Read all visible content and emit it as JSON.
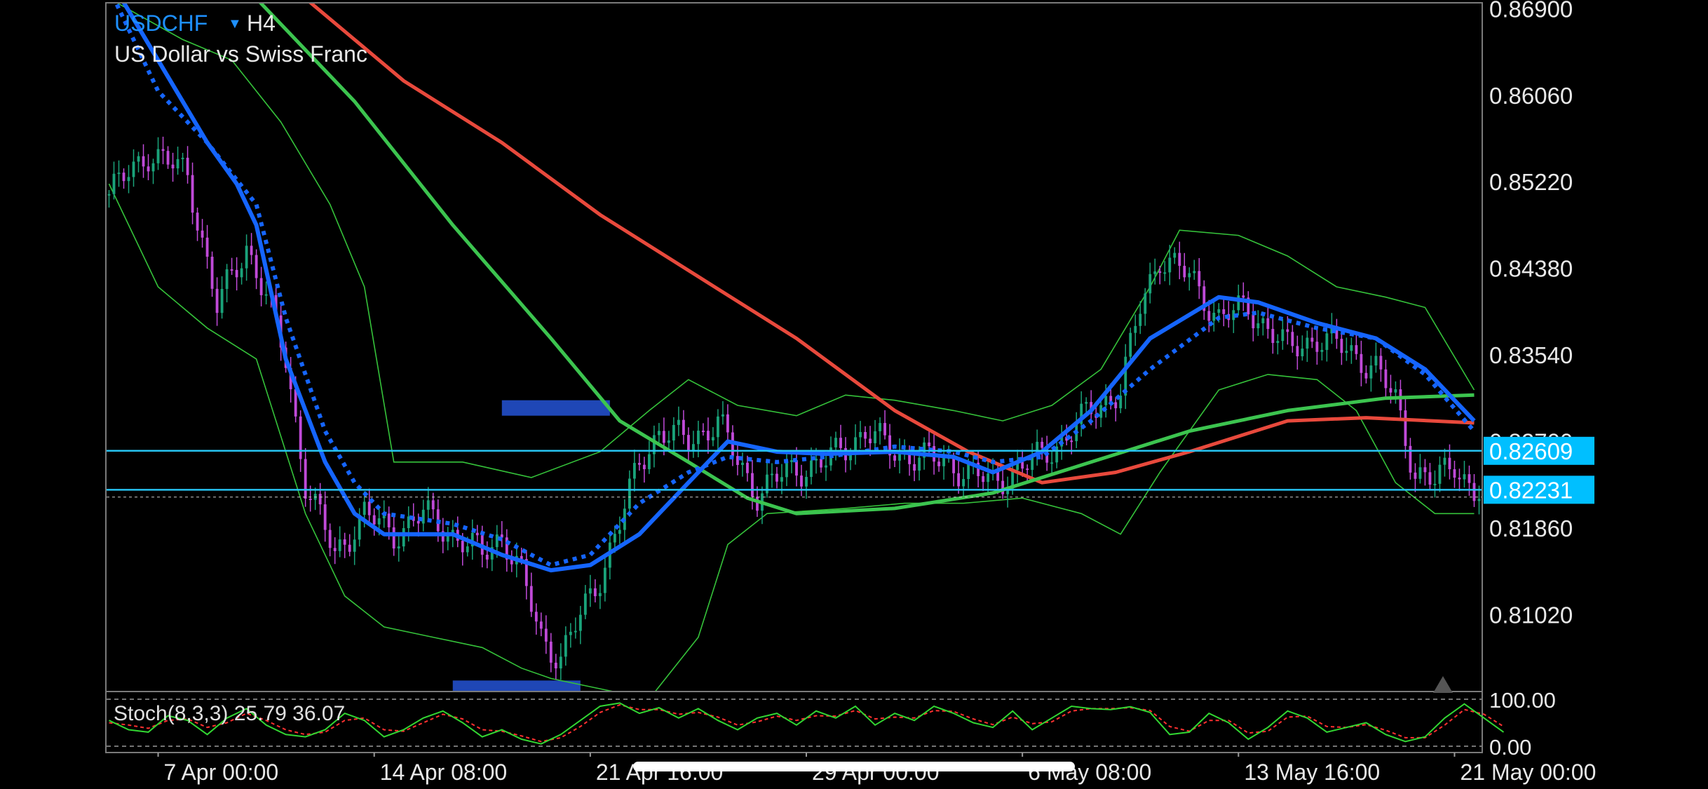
{
  "header": {
    "symbol": "USDCHF",
    "dropdown_glyph": "▼",
    "timeframe": "H4",
    "description": "US Dollar vs Swiss Franc"
  },
  "colors": {
    "background": "#000000",
    "frame": "#7a7a7a",
    "symbol": "#1E90FF",
    "bull_candle": "#1aa37a",
    "bear_candle": "#c04ad8",
    "ema_fast": "#1565ff",
    "ema_slow_dotted": "#1565ff",
    "ma_green": "#3cc44f",
    "ma_red": "#e8493c",
    "bollinger": "#35c23a",
    "hline": "#27c3f2",
    "price_tag_bg": "#00bfff",
    "zone_box": "#1f47b6",
    "stoch_main": "#32d632",
    "stoch_signal": "#ff3030"
  },
  "price_axis": {
    "labels": [
      "0.86900",
      "0.86060",
      "0.85220",
      "0.84380",
      "0.83540",
      "0.82700",
      "0.81860",
      "0.81020"
    ],
    "values": [
      0.869,
      0.8606,
      0.8522,
      0.8438,
      0.8354,
      0.827,
      0.8186,
      0.8102
    ],
    "tags": [
      {
        "label": "0.82609",
        "value": 0.82609
      },
      {
        "label": "0.82231",
        "value": 0.82231
      }
    ]
  },
  "time_axis": {
    "labels": [
      "7 Apr 00:00",
      "14 Apr 08:00",
      "21 Apr 16:00",
      "29 Apr 00:00",
      "6 May 08:00",
      "13 May 16:00",
      "21 May 00:00"
    ],
    "bar_index": [
      10,
      54,
      98,
      142,
      186,
      230,
      274
    ]
  },
  "chart_data": {
    "type": "candlestick",
    "symbol": "USDCHF",
    "timeframe": "H4",
    "ylim": [
      0.8028,
      0.8695
    ],
    "bar_count": 280,
    "horizontal_lines": [
      0.82609,
      0.82231
    ],
    "support_zone_boxes": [
      {
        "from_bar": 80,
        "to_bar": 102,
        "price_top": 0.831,
        "price_bottom": 0.8295
      },
      {
        "from_bar": 70,
        "to_bar": 96,
        "price_top": 0.8038,
        "price_bottom": 0.8025
      }
    ],
    "ema_fast": [
      [
        0,
        0.872
      ],
      [
        10,
        0.864
      ],
      [
        20,
        0.856
      ],
      [
        26,
        0.852
      ],
      [
        30,
        0.848
      ],
      [
        36,
        0.835
      ],
      [
        44,
        0.825
      ],
      [
        50,
        0.82
      ],
      [
        56,
        0.818
      ],
      [
        70,
        0.818
      ],
      [
        80,
        0.816
      ],
      [
        90,
        0.8145
      ],
      [
        98,
        0.815
      ],
      [
        108,
        0.818
      ],
      [
        118,
        0.823
      ],
      [
        126,
        0.827
      ],
      [
        136,
        0.826
      ],
      [
        146,
        0.8258
      ],
      [
        160,
        0.826
      ],
      [
        172,
        0.8255
      ],
      [
        180,
        0.824
      ],
      [
        190,
        0.826
      ],
      [
        200,
        0.83
      ],
      [
        212,
        0.837
      ],
      [
        226,
        0.841
      ],
      [
        234,
        0.8405
      ],
      [
        246,
        0.8385
      ],
      [
        258,
        0.837
      ],
      [
        268,
        0.834
      ],
      [
        278,
        0.829
      ]
    ],
    "ema_slow_dotted": [
      [
        0,
        0.871
      ],
      [
        10,
        0.861
      ],
      [
        20,
        0.856
      ],
      [
        30,
        0.85
      ],
      [
        36,
        0.839
      ],
      [
        44,
        0.828
      ],
      [
        50,
        0.823
      ],
      [
        56,
        0.82
      ],
      [
        70,
        0.819
      ],
      [
        80,
        0.8175
      ],
      [
        90,
        0.815
      ],
      [
        98,
        0.816
      ],
      [
        108,
        0.821
      ],
      [
        118,
        0.824
      ],
      [
        126,
        0.8255
      ],
      [
        136,
        0.825
      ],
      [
        146,
        0.8255
      ],
      [
        160,
        0.8265
      ],
      [
        172,
        0.826
      ],
      [
        180,
        0.825
      ],
      [
        190,
        0.8255
      ],
      [
        200,
        0.829
      ],
      [
        212,
        0.834
      ],
      [
        226,
        0.839
      ],
      [
        234,
        0.8395
      ],
      [
        246,
        0.838
      ],
      [
        258,
        0.837
      ],
      [
        268,
        0.8335
      ],
      [
        278,
        0.828
      ]
    ],
    "ma_green": [
      [
        30,
        0.87
      ],
      [
        50,
        0.86
      ],
      [
        70,
        0.848
      ],
      [
        90,
        0.837
      ],
      [
        104,
        0.829
      ],
      [
        118,
        0.825
      ],
      [
        130,
        0.8215
      ],
      [
        140,
        0.82
      ],
      [
        160,
        0.8205
      ],
      [
        180,
        0.822
      ],
      [
        200,
        0.825
      ],
      [
        220,
        0.828
      ],
      [
        240,
        0.83
      ],
      [
        260,
        0.8312
      ],
      [
        278,
        0.8315
      ]
    ],
    "ma_red": [
      [
        40,
        0.87
      ],
      [
        60,
        0.862
      ],
      [
        80,
        0.856
      ],
      [
        100,
        0.849
      ],
      [
        120,
        0.843
      ],
      [
        140,
        0.837
      ],
      [
        160,
        0.83
      ],
      [
        175,
        0.826
      ],
      [
        190,
        0.823
      ],
      [
        205,
        0.824
      ],
      [
        220,
        0.826
      ],
      [
        240,
        0.829
      ],
      [
        256,
        0.8293
      ],
      [
        278,
        0.8288
      ]
    ],
    "bollinger_upper": [
      [
        0,
        0.87
      ],
      [
        15,
        0.866
      ],
      [
        25,
        0.864
      ],
      [
        35,
        0.858
      ],
      [
        45,
        0.85
      ],
      [
        52,
        0.842
      ],
      [
        58,
        0.825
      ],
      [
        72,
        0.825
      ],
      [
        86,
        0.8235
      ],
      [
        100,
        0.826
      ],
      [
        110,
        0.83
      ],
      [
        118,
        0.833
      ],
      [
        128,
        0.8305
      ],
      [
        140,
        0.8295
      ],
      [
        150,
        0.8315
      ],
      [
        160,
        0.831
      ],
      [
        172,
        0.83
      ],
      [
        182,
        0.829
      ],
      [
        192,
        0.8305
      ],
      [
        202,
        0.834
      ],
      [
        212,
        0.842
      ],
      [
        218,
        0.8475
      ],
      [
        230,
        0.847
      ],
      [
        240,
        0.845
      ],
      [
        250,
        0.842
      ],
      [
        260,
        0.841
      ],
      [
        268,
        0.84
      ],
      [
        278,
        0.832
      ]
    ],
    "bollinger_lower": [
      [
        0,
        0.852
      ],
      [
        10,
        0.842
      ],
      [
        20,
        0.838
      ],
      [
        30,
        0.835
      ],
      [
        40,
        0.82
      ],
      [
        48,
        0.812
      ],
      [
        56,
        0.809
      ],
      [
        66,
        0.808
      ],
      [
        76,
        0.807
      ],
      [
        84,
        0.805
      ],
      [
        90,
        0.804
      ],
      [
        100,
        0.803
      ],
      [
        110,
        0.802
      ],
      [
        120,
        0.808
      ],
      [
        126,
        0.817
      ],
      [
        134,
        0.82
      ],
      [
        150,
        0.8205
      ],
      [
        162,
        0.821
      ],
      [
        174,
        0.821
      ],
      [
        186,
        0.8215
      ],
      [
        198,
        0.82
      ],
      [
        206,
        0.818
      ],
      [
        214,
        0.824
      ],
      [
        226,
        0.832
      ],
      [
        236,
        0.8335
      ],
      [
        246,
        0.833
      ],
      [
        254,
        0.83
      ],
      [
        262,
        0.823
      ],
      [
        270,
        0.82
      ],
      [
        278,
        0.82
      ]
    ],
    "price_path": [
      [
        0,
        0.851
      ],
      [
        8,
        0.855
      ],
      [
        16,
        0.853
      ],
      [
        22,
        0.84
      ],
      [
        28,
        0.846
      ],
      [
        32,
        0.841
      ],
      [
        36,
        0.835
      ],
      [
        40,
        0.823
      ],
      [
        46,
        0.816
      ],
      [
        52,
        0.82
      ],
      [
        58,
        0.818
      ],
      [
        64,
        0.82
      ],
      [
        70,
        0.818
      ],
      [
        76,
        0.816
      ],
      [
        80,
        0.818
      ],
      [
        84,
        0.814
      ],
      [
        88,
        0.808
      ],
      [
        92,
        0.806
      ],
      [
        96,
        0.81
      ],
      [
        100,
        0.814
      ],
      [
        104,
        0.819
      ],
      [
        108,
        0.825
      ],
      [
        112,
        0.828
      ],
      [
        118,
        0.827
      ],
      [
        124,
        0.829
      ],
      [
        128,
        0.825
      ],
      [
        132,
        0.822
      ],
      [
        138,
        0.824
      ],
      [
        146,
        0.825
      ],
      [
        154,
        0.828
      ],
      [
        160,
        0.826
      ],
      [
        170,
        0.825
      ],
      [
        180,
        0.823
      ],
      [
        188,
        0.825
      ],
      [
        194,
        0.827
      ],
      [
        200,
        0.83
      ],
      [
        206,
        0.832
      ],
      [
        210,
        0.84
      ],
      [
        214,
        0.845
      ],
      [
        220,
        0.843
      ],
      [
        226,
        0.839
      ],
      [
        232,
        0.84
      ],
      [
        240,
        0.836
      ],
      [
        246,
        0.837
      ],
      [
        252,
        0.836
      ],
      [
        258,
        0.834
      ],
      [
        262,
        0.831
      ],
      [
        266,
        0.824
      ],
      [
        270,
        0.823
      ],
      [
        274,
        0.825
      ],
      [
        278,
        0.822
      ]
    ],
    "stoch": {
      "label": "Stoch(8,3,3) 25.79 36.07",
      "levels": [
        "100.00",
        "0.00"
      ],
      "range": [
        0,
        100
      ],
      "main": [
        [
          0,
          55
        ],
        [
          4,
          35
        ],
        [
          8,
          30
        ],
        [
          12,
          65
        ],
        [
          16,
          55
        ],
        [
          20,
          25
        ],
        [
          24,
          60
        ],
        [
          28,
          80
        ],
        [
          32,
          45
        ],
        [
          36,
          25
        ],
        [
          40,
          20
        ],
        [
          44,
          35
        ],
        [
          48,
          70
        ],
        [
          52,
          55
        ],
        [
          56,
          20
        ],
        [
          60,
          35
        ],
        [
          64,
          60
        ],
        [
          68,
          75
        ],
        [
          72,
          50
        ],
        [
          76,
          20
        ],
        [
          80,
          35
        ],
        [
          84,
          15
        ],
        [
          88,
          5
        ],
        [
          92,
          25
        ],
        [
          96,
          55
        ],
        [
          100,
          85
        ],
        [
          104,
          92
        ],
        [
          108,
          70
        ],
        [
          112,
          82
        ],
        [
          116,
          60
        ],
        [
          120,
          80
        ],
        [
          124,
          55
        ],
        [
          128,
          35
        ],
        [
          132,
          60
        ],
        [
          136,
          70
        ],
        [
          140,
          45
        ],
        [
          144,
          75
        ],
        [
          148,
          60
        ],
        [
          152,
          85
        ],
        [
          156,
          45
        ],
        [
          160,
          70
        ],
        [
          164,
          55
        ],
        [
          168,
          85
        ],
        [
          172,
          70
        ],
        [
          176,
          50
        ],
        [
          180,
          40
        ],
        [
          184,
          75
        ],
        [
          188,
          35
        ],
        [
          192,
          60
        ],
        [
          196,
          85
        ],
        [
          200,
          80
        ],
        [
          204,
          78
        ],
        [
          208,
          84
        ],
        [
          212,
          72
        ],
        [
          216,
          25
        ],
        [
          220,
          30
        ],
        [
          224,
          70
        ],
        [
          228,
          50
        ],
        [
          232,
          15
        ],
        [
          236,
          40
        ],
        [
          240,
          75
        ],
        [
          244,
          60
        ],
        [
          248,
          30
        ],
        [
          252,
          40
        ],
        [
          256,
          50
        ],
        [
          260,
          25
        ],
        [
          264,
          10
        ],
        [
          268,
          20
        ],
        [
          272,
          60
        ],
        [
          276,
          90
        ],
        [
          280,
          60
        ],
        [
          284,
          30
        ]
      ],
      "signal": [
        [
          0,
          50
        ],
        [
          4,
          45
        ],
        [
          8,
          38
        ],
        [
          12,
          55
        ],
        [
          16,
          58
        ],
        [
          20,
          40
        ],
        [
          24,
          50
        ],
        [
          28,
          70
        ],
        [
          32,
          55
        ],
        [
          36,
          35
        ],
        [
          40,
          25
        ],
        [
          44,
          30
        ],
        [
          48,
          55
        ],
        [
          52,
          60
        ],
        [
          56,
          35
        ],
        [
          60,
          32
        ],
        [
          64,
          50
        ],
        [
          68,
          68
        ],
        [
          72,
          58
        ],
        [
          76,
          35
        ],
        [
          80,
          32
        ],
        [
          84,
          22
        ],
        [
          88,
          10
        ],
        [
          92,
          18
        ],
        [
          96,
          42
        ],
        [
          100,
          72
        ],
        [
          104,
          88
        ],
        [
          108,
          78
        ],
        [
          112,
          78
        ],
        [
          116,
          68
        ],
        [
          120,
          72
        ],
        [
          124,
          62
        ],
        [
          128,
          45
        ],
        [
          132,
          52
        ],
        [
          136,
          64
        ],
        [
          140,
          55
        ],
        [
          144,
          65
        ],
        [
          148,
          64
        ],
        [
          152,
          76
        ],
        [
          156,
          58
        ],
        [
          160,
          62
        ],
        [
          164,
          60
        ],
        [
          168,
          76
        ],
        [
          172,
          74
        ],
        [
          176,
          58
        ],
        [
          180,
          46
        ],
        [
          184,
          62
        ],
        [
          188,
          48
        ],
        [
          192,
          52
        ],
        [
          196,
          75
        ],
        [
          200,
          80
        ],
        [
          204,
          80
        ],
        [
          208,
          82
        ],
        [
          212,
          76
        ],
        [
          216,
          42
        ],
        [
          220,
          32
        ],
        [
          224,
          55
        ],
        [
          228,
          55
        ],
        [
          232,
          28
        ],
        [
          236,
          32
        ],
        [
          240,
          62
        ],
        [
          244,
          64
        ],
        [
          248,
          42
        ],
        [
          252,
          40
        ],
        [
          256,
          46
        ],
        [
          260,
          34
        ],
        [
          264,
          18
        ],
        [
          268,
          18
        ],
        [
          272,
          45
        ],
        [
          276,
          78
        ],
        [
          280,
          68
        ],
        [
          284,
          42
        ]
      ]
    }
  }
}
